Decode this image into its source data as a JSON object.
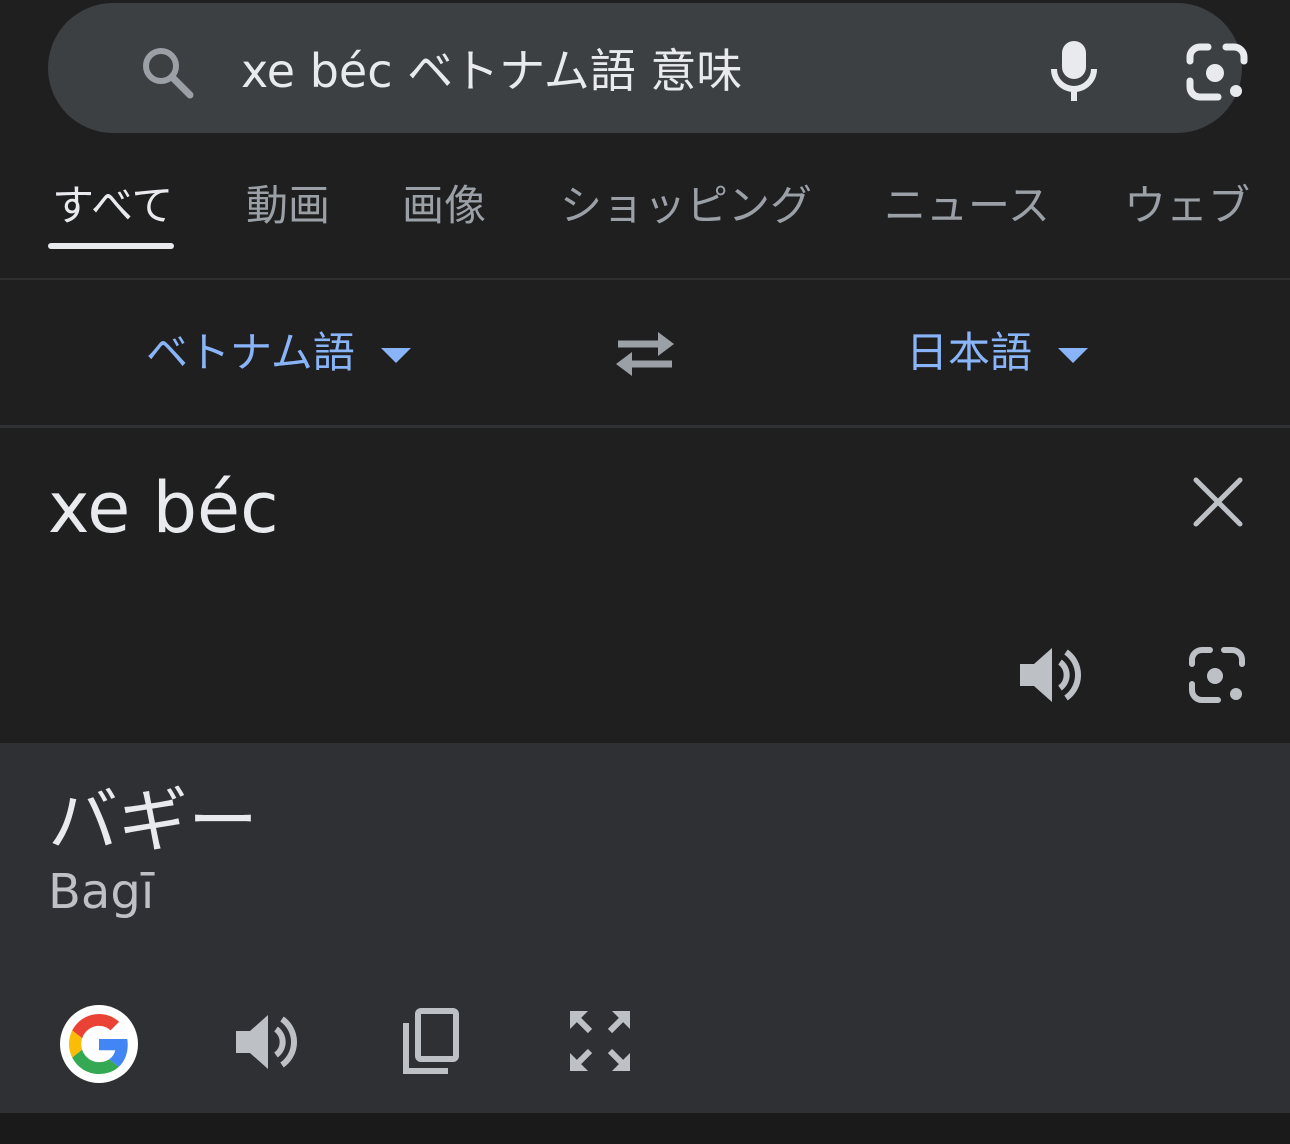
{
  "search": {
    "query": "xe béc ベトナム語 意味",
    "icons": [
      "search-icon",
      "mic-icon",
      "google-lens-icon"
    ]
  },
  "tabs": [
    {
      "label": "すべて",
      "active": true
    },
    {
      "label": "動画"
    },
    {
      "label": "画像"
    },
    {
      "label": "ショッピング"
    },
    {
      "label": "ニュース"
    },
    {
      "label": "ウェブ"
    }
  ],
  "translator": {
    "source_lang": "ベトナム語",
    "target_lang": "日本語",
    "source_text": "xe béc",
    "result_text": "バギー",
    "romanization": "Bagī"
  },
  "colors": {
    "background": "#1f1f20",
    "search_bar": "#3c4043",
    "result_panel": "#2f3034",
    "accent": "#8ab4f8",
    "text": "#e8eaed",
    "muted": "#9aa0a6"
  }
}
